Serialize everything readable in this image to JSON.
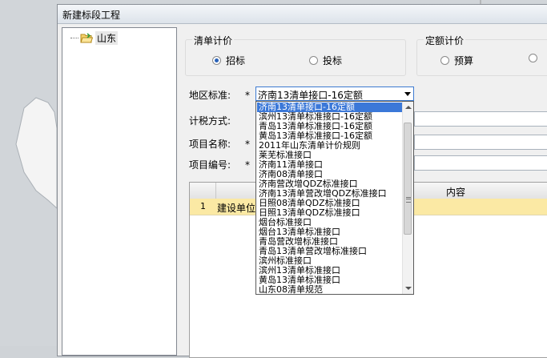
{
  "window": {
    "title": "新建标段工程"
  },
  "tree": {
    "root_label": "山东"
  },
  "bill_pricing": {
    "title": "清单计价",
    "options": [
      {
        "label": "招标",
        "selected": true
      },
      {
        "label": "投标",
        "selected": false
      }
    ]
  },
  "quota_pricing": {
    "title": "定额计价",
    "options": [
      {
        "label": "预算",
        "selected": false
      }
    ]
  },
  "form": {
    "region_label": "地区标准:",
    "tax_label": "计税方式:",
    "name_label": "项目名称:",
    "code_label": "项目编号:",
    "required_mark": "*",
    "region_value": "济南13清单接口-16定额"
  },
  "dropdown": {
    "options": [
      "济南13清单接口-16定额",
      "滨州13清单标准接口-16定额",
      "青岛13清单标准接口-16定额",
      "黄岛13清单标准接口-16定额",
      "2011年山东清单计价规则",
      "莱芜标准接口",
      "济南11清单接口",
      "济南08清单接口",
      "济南营改增QDZ标准接口",
      "济南13清单营改增QDZ标准接口",
      "日照08清单QDZ标准接口",
      "日照13清单QDZ标准接口",
      "烟台标准接口",
      "烟台13清单标准接口",
      "青岛营改增标准接口",
      "青岛13清单营改增标准接口",
      "滨州标准接口",
      "滨州13清单标准接口",
      "黄岛13清单标准接口",
      "山东08清单规范"
    ],
    "selected_index": 0
  },
  "grid": {
    "content_header": "内容",
    "rows": [
      {
        "num": "1",
        "name": "建设单位"
      }
    ]
  },
  "colors": {
    "accent": "#3b78d8",
    "row_highlight": "#fbe9a4"
  }
}
